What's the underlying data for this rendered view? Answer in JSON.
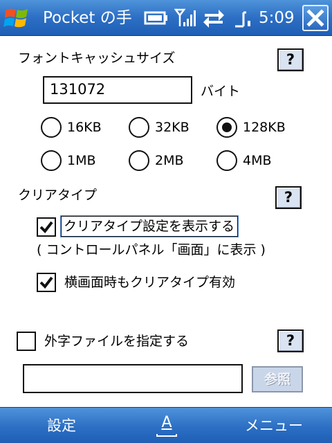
{
  "titlebar": {
    "start_icon": "windows-flag-icon",
    "title": "Pocket の手",
    "time": "5:09",
    "status_icons": [
      "battery-icon",
      "signal-icon",
      "data-sync-icon",
      "volume-icon"
    ],
    "close_icon": "close-icon"
  },
  "font_cache": {
    "label": "フォントキャッシュサイズ",
    "help_label": "?",
    "value": "131072",
    "unit": "バイト",
    "options": [
      "16KB",
      "32KB",
      "128KB",
      "1MB",
      "2MB",
      "4MB"
    ],
    "selected": "128KB"
  },
  "cleartype": {
    "label": "クリアタイプ",
    "help_label": "?",
    "show_settings_label": "クリアタイプ設定を表示する",
    "show_settings_checked": true,
    "note": "( コントロールパネル「画面」に表示 )",
    "landscape_label": "横画面時もクリアタイプ有効",
    "landscape_checked": true
  },
  "external_char": {
    "label": "外字ファイルを指定する",
    "checked": false,
    "help_label": "?",
    "path_value": "",
    "browse_label": "参照"
  },
  "softkeys": {
    "left": "設定",
    "sip_letter": "A",
    "right": "メニュー"
  },
  "colors": {
    "bar_blue": "#2c6fc4",
    "help_bg": "#d9e3f1"
  }
}
